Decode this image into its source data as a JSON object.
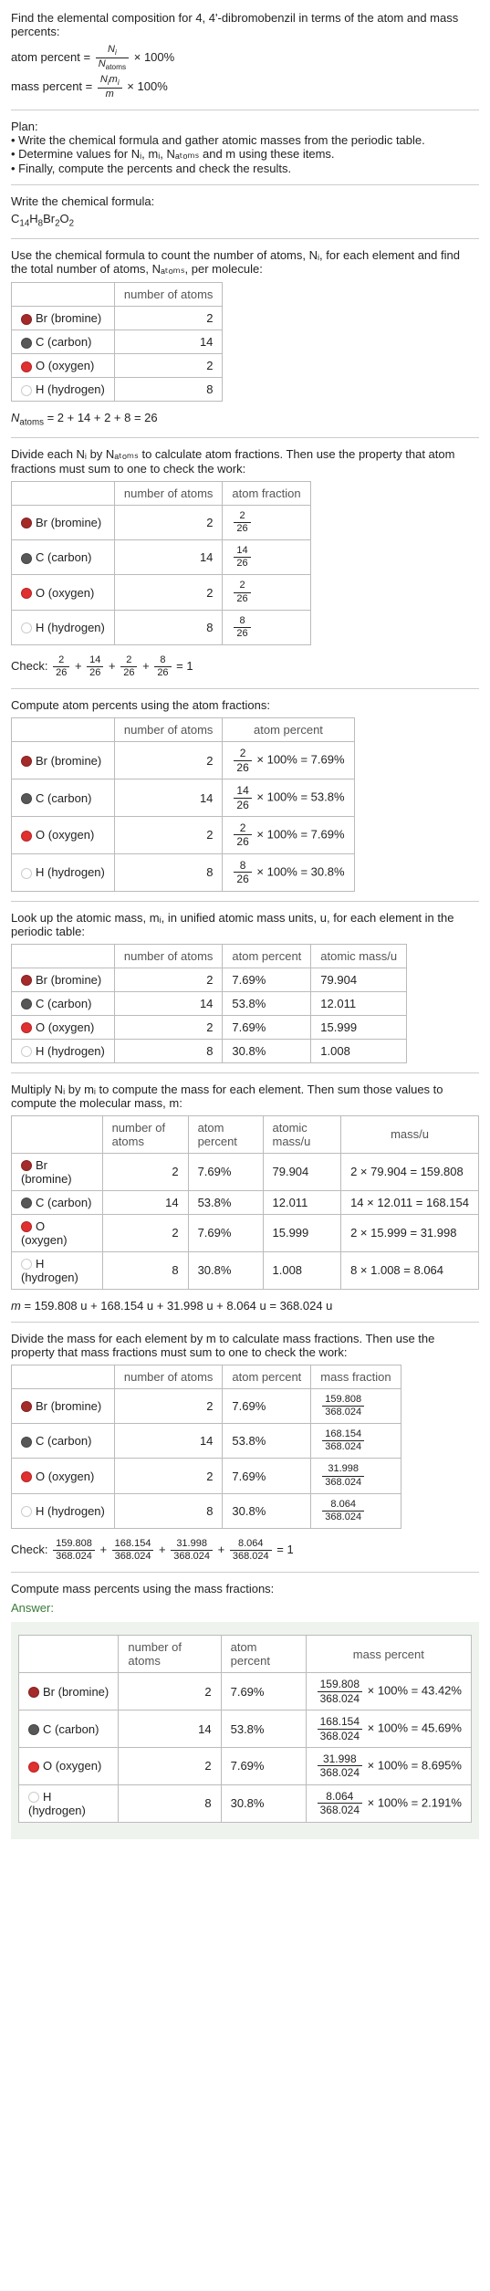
{
  "intro": {
    "prompt": "Find the elemental composition for 4, 4'-dibromobenzil in terms of the atom and mass percents:",
    "atom_percent_label": "atom percent = ",
    "atom_percent_times": " × 100%",
    "mass_percent_label": "mass percent = ",
    "mass_percent_times": " × 100%",
    "Ni": "N",
    "Ni_sub": "i",
    "Natoms": "N",
    "Natoms_sub": "atoms",
    "Nimi": "N",
    "Nimi_sub1": "i",
    "mi": "m",
    "mi_sub": "i",
    "m": "m"
  },
  "plan": {
    "title": "Plan:",
    "items": [
      "Write the chemical formula and gather atomic masses from the periodic table.",
      "Determine values for Nᵢ, mᵢ, Nₐₜₒₘₛ and m using these items.",
      "Finally, compute the percents and check the results."
    ]
  },
  "write_formula": {
    "heading": "Write the chemical formula:",
    "formula_parts": [
      "C",
      "14",
      "H",
      "8",
      "Br",
      "2",
      "O",
      "2"
    ]
  },
  "count_atoms": {
    "text": "Use the chemical formula to count the number of atoms, Nᵢ, for each element and find the total number of atoms, Nₐₜₒₘₛ, per molecule:",
    "headers": [
      "",
      "number of atoms"
    ],
    "rows": [
      {
        "color": "#a52a2a",
        "name": "Br (bromine)",
        "n": "2"
      },
      {
        "color": "#575757",
        "name": "C (carbon)",
        "n": "14"
      },
      {
        "color": "#e03030",
        "name": "O (oxygen)",
        "n": "2"
      },
      {
        "color": "#ffffff",
        "name": "H (hydrogen)",
        "n": "8"
      }
    ],
    "sum_label": "Nₐₜₒₘₛ = 2 + 14 + 2 + 8 = 26"
  },
  "atom_fractions": {
    "text": "Divide each Nᵢ by Nₐₜₒₘₛ to calculate atom fractions. Then use the property that atom fractions must sum to one to check the work:",
    "headers": [
      "",
      "number of atoms",
      "atom fraction"
    ],
    "rows": [
      {
        "color": "#a52a2a",
        "name": "Br (bromine)",
        "n": "2",
        "num": "2",
        "den": "26"
      },
      {
        "color": "#575757",
        "name": "C (carbon)",
        "n": "14",
        "num": "14",
        "den": "26"
      },
      {
        "color": "#e03030",
        "name": "O (oxygen)",
        "n": "2",
        "num": "2",
        "den": "26"
      },
      {
        "color": "#ffffff",
        "name": "H (hydrogen)",
        "n": "8",
        "num": "8",
        "den": "26"
      }
    ],
    "check_prefix": "Check: ",
    "check_terms": [
      {
        "num": "2",
        "den": "26"
      },
      {
        "num": "14",
        "den": "26"
      },
      {
        "num": "2",
        "den": "26"
      },
      {
        "num": "8",
        "den": "26"
      }
    ],
    "check_suffix": " = 1"
  },
  "atom_percents": {
    "text": "Compute atom percents using the atom fractions:",
    "headers": [
      "",
      "number of atoms",
      "atom percent"
    ],
    "rows": [
      {
        "color": "#a52a2a",
        "name": "Br (bromine)",
        "n": "2",
        "num": "2",
        "den": "26",
        "pct": "7.69%"
      },
      {
        "color": "#575757",
        "name": "C (carbon)",
        "n": "14",
        "num": "14",
        "den": "26",
        "pct": "53.8%"
      },
      {
        "color": "#e03030",
        "name": "O (oxygen)",
        "n": "2",
        "num": "2",
        "den": "26",
        "pct": "7.69%"
      },
      {
        "color": "#ffffff",
        "name": "H (hydrogen)",
        "n": "8",
        "num": "8",
        "den": "26",
        "pct": "30.8%"
      }
    ],
    "times100": " × 100% = "
  },
  "atomic_mass": {
    "text": "Look up the atomic mass, mᵢ, in unified atomic mass units, u, for each element in the periodic table:",
    "headers": [
      "",
      "number of atoms",
      "atom percent",
      "atomic mass/u"
    ],
    "rows": [
      {
        "color": "#a52a2a",
        "name": "Br (bromine)",
        "n": "2",
        "pct": "7.69%",
        "mass": "79.904"
      },
      {
        "color": "#575757",
        "name": "C (carbon)",
        "n": "14",
        "pct": "53.8%",
        "mass": "12.011"
      },
      {
        "color": "#e03030",
        "name": "O (oxygen)",
        "n": "2",
        "pct": "7.69%",
        "mass": "15.999"
      },
      {
        "color": "#ffffff",
        "name": "H (hydrogen)",
        "n": "8",
        "pct": "30.8%",
        "mass": "1.008"
      }
    ]
  },
  "mass_calc": {
    "text": "Multiply Nᵢ by mᵢ to compute the mass for each element. Then sum those values to compute the molecular mass, m:",
    "headers": [
      "",
      "number of atoms",
      "atom percent",
      "atomic mass/u",
      "mass/u"
    ],
    "rows": [
      {
        "color": "#a52a2a",
        "name": "Br (bromine)",
        "n": "2",
        "pct": "7.69%",
        "amass": "79.904",
        "calc": "2 × 79.904 = 159.808"
      },
      {
        "color": "#575757",
        "name": "C (carbon)",
        "n": "14",
        "pct": "53.8%",
        "amass": "12.011",
        "calc": "14 × 12.011 = 168.154"
      },
      {
        "color": "#e03030",
        "name": "O (oxygen)",
        "n": "2",
        "pct": "7.69%",
        "amass": "15.999",
        "calc": "2 × 15.999 = 31.998"
      },
      {
        "color": "#ffffff",
        "name": "H (hydrogen)",
        "n": "8",
        "pct": "30.8%",
        "amass": "1.008",
        "calc": "8 × 1.008 = 8.064"
      }
    ],
    "sum": "m = 159.808 u + 168.154 u + 31.998 u + 8.064 u = 368.024 u"
  },
  "mass_fractions": {
    "text": "Divide the mass for each element by m to calculate mass fractions. Then use the property that mass fractions must sum to one to check the work:",
    "headers": [
      "",
      "number of atoms",
      "atom percent",
      "mass fraction"
    ],
    "rows": [
      {
        "color": "#a52a2a",
        "name": "Br (bromine)",
        "n": "2",
        "pct": "7.69%",
        "num": "159.808",
        "den": "368.024"
      },
      {
        "color": "#575757",
        "name": "C (carbon)",
        "n": "14",
        "pct": "53.8%",
        "num": "168.154",
        "den": "368.024"
      },
      {
        "color": "#e03030",
        "name": "O (oxygen)",
        "n": "2",
        "pct": "7.69%",
        "num": "31.998",
        "den": "368.024"
      },
      {
        "color": "#ffffff",
        "name": "H (hydrogen)",
        "n": "8",
        "pct": "30.8%",
        "num": "8.064",
        "den": "368.024"
      }
    ],
    "check_prefix": "Check: ",
    "check_terms": [
      {
        "num": "159.808",
        "den": "368.024"
      },
      {
        "num": "168.154",
        "den": "368.024"
      },
      {
        "num": "31.998",
        "den": "368.024"
      },
      {
        "num": "8.064",
        "den": "368.024"
      }
    ],
    "check_suffix": " = 1"
  },
  "mass_percents": {
    "text": "Compute mass percents using the mass fractions:",
    "answer_label": "Answer:",
    "headers": [
      "",
      "number of atoms",
      "atom percent",
      "mass percent"
    ],
    "rows": [
      {
        "color": "#a52a2a",
        "name": "Br (bromine)",
        "n": "2",
        "pct": "7.69%",
        "num": "159.808",
        "den": "368.024",
        "result": "43.42%"
      },
      {
        "color": "#575757",
        "name": "C (carbon)",
        "n": "14",
        "pct": "53.8%",
        "num": "168.154",
        "den": "368.024",
        "result": "45.69%"
      },
      {
        "color": "#e03030",
        "name": "O (oxygen)",
        "n": "2",
        "pct": "7.69%",
        "num": "31.998",
        "den": "368.024",
        "result": "8.695%"
      },
      {
        "color": "#ffffff",
        "name": "H (hydrogen)",
        "n": "8",
        "pct": "30.8%",
        "num": "8.064",
        "den": "368.024",
        "result": "2.191%"
      }
    ],
    "times100": " × 100% = "
  }
}
